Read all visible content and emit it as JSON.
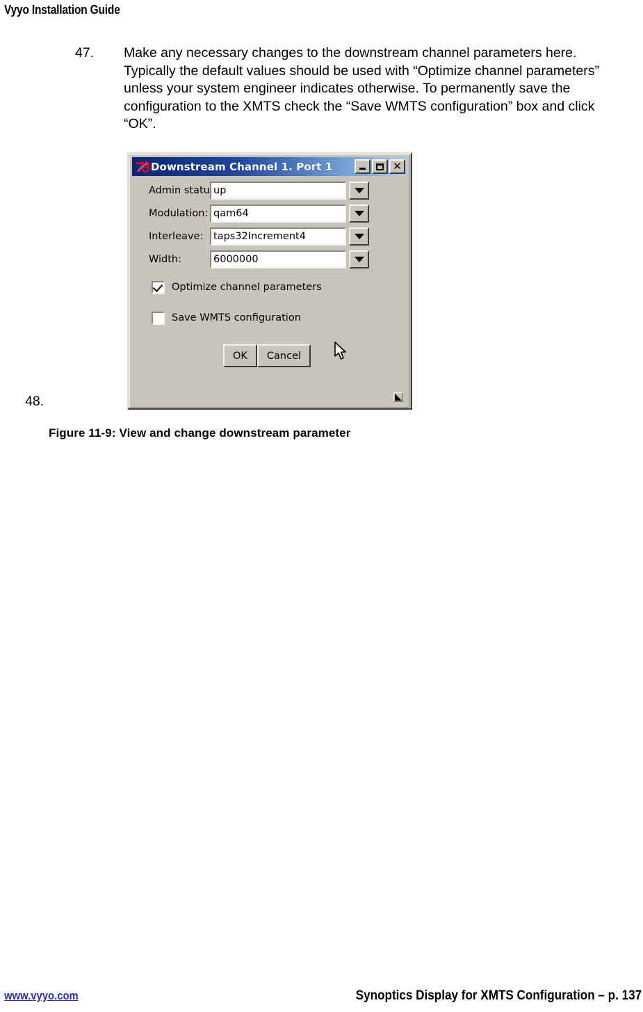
{
  "header": {
    "title": "Vyyo Installation Guide"
  },
  "steps": [
    {
      "number": "47.",
      "text": "Make any necessary changes to the downstream channel parameters here.  Typically the default values should be used with “Optimize channel parameters” unless your system engineer indicates otherwise.  To permanently save the configuration to the XMTS check the “Save WMTS configuration” box and click “OK”."
    },
    {
      "number": "48.",
      "text": ""
    }
  ],
  "figure": {
    "caption": "Figure 11-9: View and change downstream parameter"
  },
  "dialog": {
    "title": "Downstream Channel 1. Port 1",
    "icon": "vyyo-76-logo-icon",
    "title_buttons": {
      "minimize": "minimize-button",
      "maximize": "maximize-button",
      "close": "close-button"
    },
    "fields": [
      {
        "label": "Admin status:",
        "value": "up"
      },
      {
        "label": "Modulation:",
        "value": "qam64"
      },
      {
        "label": "Interleave:",
        "value": "taps32Increment4"
      },
      {
        "label": "Width:",
        "value": "6000000"
      }
    ],
    "checkboxes": [
      {
        "label": "Optimize channel parameters",
        "checked": true
      },
      {
        "label": "Save WMTS configuration",
        "checked": false
      }
    ],
    "buttons": {
      "ok": "OK",
      "cancel": "Cancel"
    },
    "colors": {
      "titlebar_start": "#0a2473",
      "titlebar_end": "#aecbe9",
      "face": "#c8c4bc",
      "icon_red": "#cc0022"
    }
  },
  "footer": {
    "link": "www.vyyo.com",
    "link_color": "#2f31a8",
    "right": "Synoptics Display for XMTS Configuration – p. 137"
  }
}
